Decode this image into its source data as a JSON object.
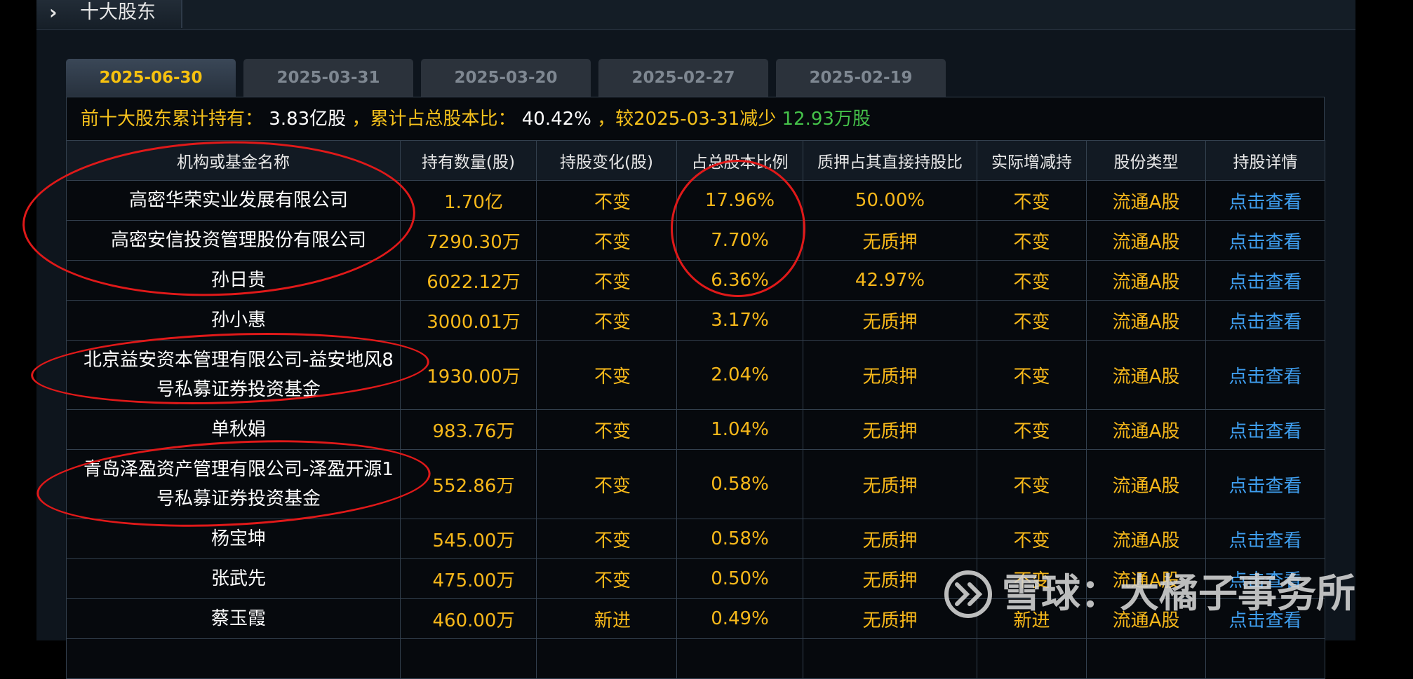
{
  "header": {
    "title": "十大股东"
  },
  "tabs": [
    "2025-06-30",
    "2025-03-31",
    "2025-03-20",
    "2025-02-27",
    "2025-02-19"
  ],
  "active_tab": 0,
  "summary": {
    "prefix": "前十大股东累计持有：",
    "total": "3.83亿股",
    "ratio_label": "，累计占总股本比：",
    "ratio": "40.42%",
    "compare_label": "，较2025-03-31减少",
    "change": "12.93万股"
  },
  "columns": [
    "机构或基金名称",
    "持有数量(股)",
    "持股变化(股)",
    "占总股本比例",
    "质押占其直接持股比",
    "实际增减持",
    "股份类型",
    "持股详情"
  ],
  "rows": [
    {
      "name": "高密华荣实业发展有限公司",
      "qty": "1.70亿",
      "change": "不变",
      "pct": "17.96%",
      "pledge": "50.00%",
      "actual": "不变",
      "type": "流通A股",
      "detail": "点击查看"
    },
    {
      "name": "高密安信投资管理股份有限公司",
      "qty": "7290.30万",
      "change": "不变",
      "pct": "7.70%",
      "pledge": "无质押",
      "actual": "不变",
      "type": "流通A股",
      "detail": "点击查看"
    },
    {
      "name": "孙日贵",
      "qty": "6022.12万",
      "change": "不变",
      "pct": "6.36%",
      "pledge": "42.97%",
      "actual": "不变",
      "type": "流通A股",
      "detail": "点击查看"
    },
    {
      "name": "孙小惠",
      "qty": "3000.01万",
      "change": "不变",
      "pct": "3.17%",
      "pledge": "无质押",
      "actual": "不变",
      "type": "流通A股",
      "detail": "点击查看"
    },
    {
      "name": "北京益安资本管理有限公司-益安地风8号私募证券投资基金",
      "qty": "1930.00万",
      "change": "不变",
      "pct": "2.04%",
      "pledge": "无质押",
      "actual": "不变",
      "type": "流通A股",
      "detail": "点击查看"
    },
    {
      "name": "单秋娟",
      "qty": "983.76万",
      "change": "不变",
      "pct": "1.04%",
      "pledge": "无质押",
      "actual": "不变",
      "type": "流通A股",
      "detail": "点击查看"
    },
    {
      "name": "青岛泽盈资产管理有限公司-泽盈开源1号私募证券投资基金",
      "qty": "552.86万",
      "change": "不变",
      "pct": "0.58%",
      "pledge": "无质押",
      "actual": "不变",
      "type": "流通A股",
      "detail": "点击查看"
    },
    {
      "name": "杨宝坤",
      "qty": "545.00万",
      "change": "不变",
      "pct": "0.58%",
      "pledge": "无质押",
      "actual": "不变",
      "type": "流通A股",
      "detail": "点击查看"
    },
    {
      "name": "张武先",
      "qty": "475.00万",
      "change": "不变",
      "pct": "0.50%",
      "pledge": "无质押",
      "actual": "不变",
      "type": "流通A股",
      "detail": "点击查看"
    },
    {
      "name": "蔡玉霞",
      "qty": "460.00万",
      "change": "新进",
      "pct": "0.49%",
      "pledge": "无质押",
      "actual": "新进",
      "type": "流通A股",
      "detail": "点击查看"
    }
  ],
  "watermark": {
    "text": "雪球：大橘子事务所"
  },
  "colors": {
    "accent": "#f7c21c",
    "link": "#3f9ff0",
    "new": "#e02020",
    "decrease": "#45c24a",
    "annotation": "#e01919"
  }
}
